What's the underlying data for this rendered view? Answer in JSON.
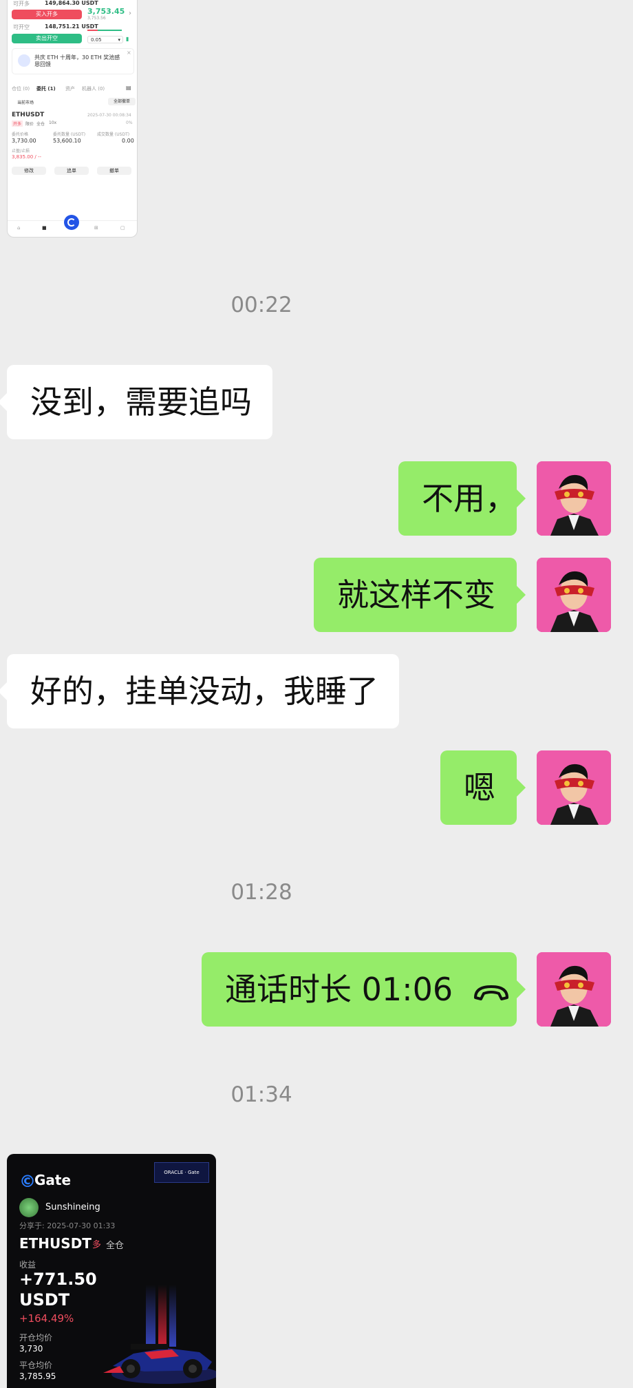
{
  "thumbnail": {
    "available_label": "可开多",
    "available_value": "149,864.30 USDT",
    "open_long_button": "买入开多",
    "price_main": "3,753.45",
    "price_sub": "3,753.56",
    "available_short_label": "可开空",
    "available_short_value": "148,751.21 USDT",
    "open_short_button": "卖出开空",
    "qty_value": "0.05",
    "banner_text": "共庆 ETH 十周年，30 ETH 奖池感恩回馈",
    "tabs": [
      "仓位 (0)",
      "委托 (1)",
      "资产",
      "机器人 (0)"
    ],
    "current_market": "当前市场",
    "cancel_all": "全部撤单",
    "symbol": "ETHUSDT",
    "order_time": "2025-07-30 00:08:34",
    "tags": [
      "开多",
      "限价",
      "全仓",
      "10x"
    ],
    "progress": "0%",
    "col_headers": [
      "委托价格",
      "委托数量 (USDT)",
      "成交数量 (USDT)"
    ],
    "col_values": [
      "3,730.00",
      "53,600.10",
      "0.00"
    ],
    "stop_label": "止盈/止损",
    "stop_value": "3,835.00 / --",
    "actions": [
      "修改",
      "追单",
      "撤单"
    ],
    "nav": [
      "首页",
      "行情",
      "交易",
      "理财",
      "资产"
    ]
  },
  "messages": [
    {
      "time": "00:22"
    },
    {
      "side": "left",
      "text": "没到，需要追吗"
    },
    {
      "side": "right",
      "text": "不用，"
    },
    {
      "side": "right",
      "text": "就这样不变"
    },
    {
      "side": "left",
      "text": "好的，挂单没动，我睡了"
    },
    {
      "side": "right",
      "text": "嗯"
    },
    {
      "time": "01:28"
    },
    {
      "side": "right",
      "text": "通话时长 01:06"
    },
    {
      "time": "01:34"
    }
  ],
  "call_icon": "phone-hangup-icon",
  "card": {
    "brand": "Gate",
    "partner_badge": "ORACLE · Gate",
    "username": "Sunshineing",
    "share_time": "分享于: 2025-07-30 01:33",
    "symbol": "ETHUSDT",
    "mode": "全仓",
    "pnl_label": "收益",
    "pnl_value": "+771.50",
    "pnl_unit": "USDT",
    "pnl_percent": "+164.49%",
    "open_avg_label": "开仓均价",
    "open_avg_value": "3,730",
    "close_avg_label": "平仓均价",
    "close_avg_value": "3,785.95"
  },
  "colors": {
    "bubble_sent": "#95ec69",
    "bubble_received": "#ffffff",
    "background": "#ededed",
    "profit_red": "#ef4d5e",
    "gate_blue": "#2354e6"
  }
}
